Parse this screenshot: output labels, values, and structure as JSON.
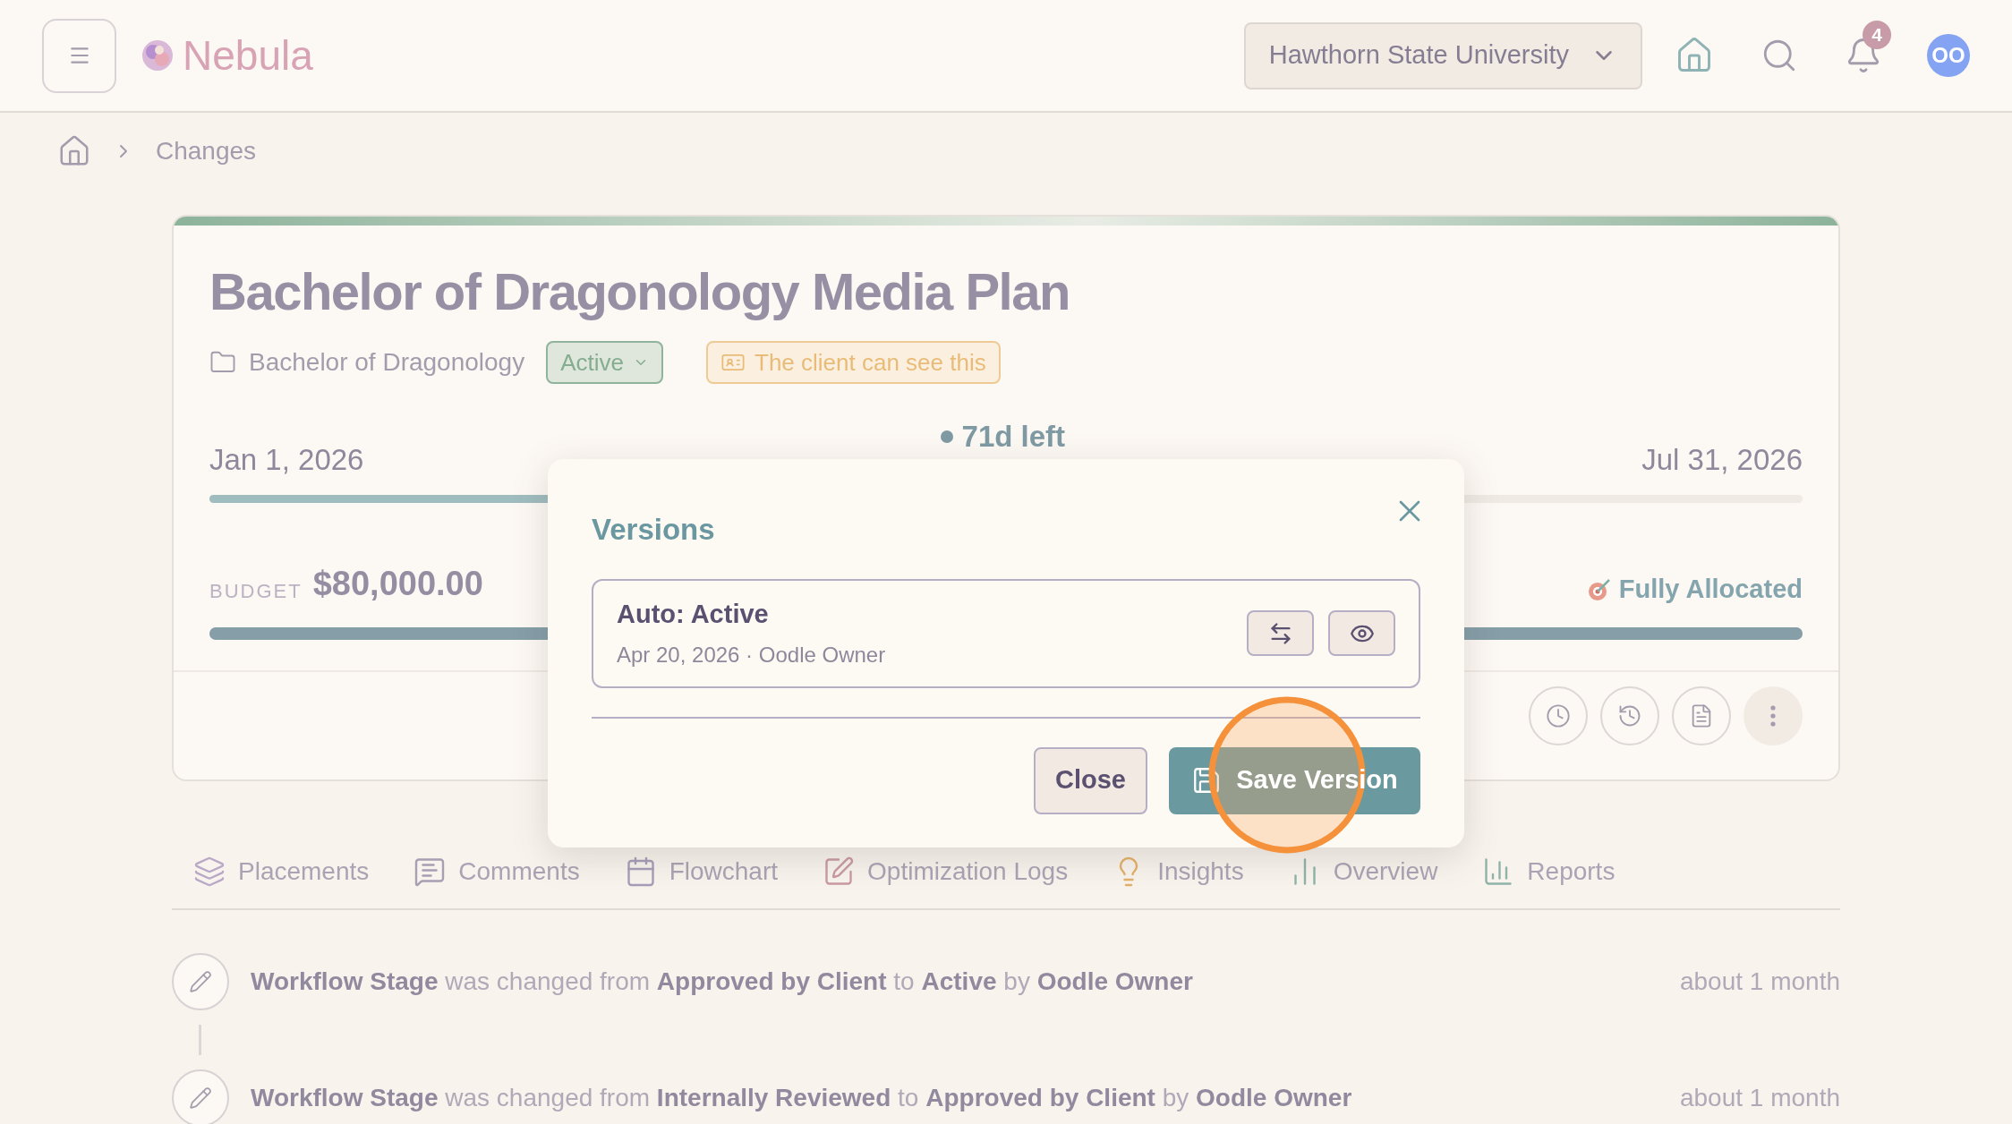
{
  "header": {
    "logo_text": "Nebula",
    "org_selector": "Hawthorn State University",
    "notification_count": "4",
    "avatar_initials": "OO"
  },
  "breadcrumb": [
    {
      "label": "Changes"
    }
  ],
  "plan": {
    "title": "Bachelor of Dragonology Media Plan",
    "folder": "Bachelor of Dragonology",
    "status": "Active",
    "visibility_badge": "The client can see this",
    "start_date": "Jan 1, 2026",
    "time_left": "71d left",
    "end_date": "Jul 31, 2026",
    "timeline": {
      "level": 0.66
    },
    "budget_label": "BUDGET",
    "budget": "$80,000.00",
    "allocation": "Fully Allocated",
    "budget_bar": {
      "level": 1
    }
  },
  "tabs": [
    {
      "label": "Placements"
    },
    {
      "label": "Comments"
    },
    {
      "label": "Flowchart"
    },
    {
      "label": "Optimization Logs"
    },
    {
      "label": "Insights"
    },
    {
      "label": "Overview"
    },
    {
      "label": "Reports"
    }
  ],
  "activity": [
    {
      "text": "**Workflow Stage** was changed from **Approved by Client** to **Active** by **Oodle Owner**",
      "time": "about 1 month"
    },
    {
      "text": "**Workflow Stage** was changed from **Internally Reviewed** to **Approved by Client** by **Oodle Owner**",
      "time": "about 1 month"
    }
  ],
  "modal": {
    "title": "Versions",
    "versions": [
      {
        "title": "Auto: Active",
        "meta": "Apr 20, 2026 · Oodle Owner"
      }
    ],
    "close_button": "Close",
    "save_button": "Save Version"
  }
}
